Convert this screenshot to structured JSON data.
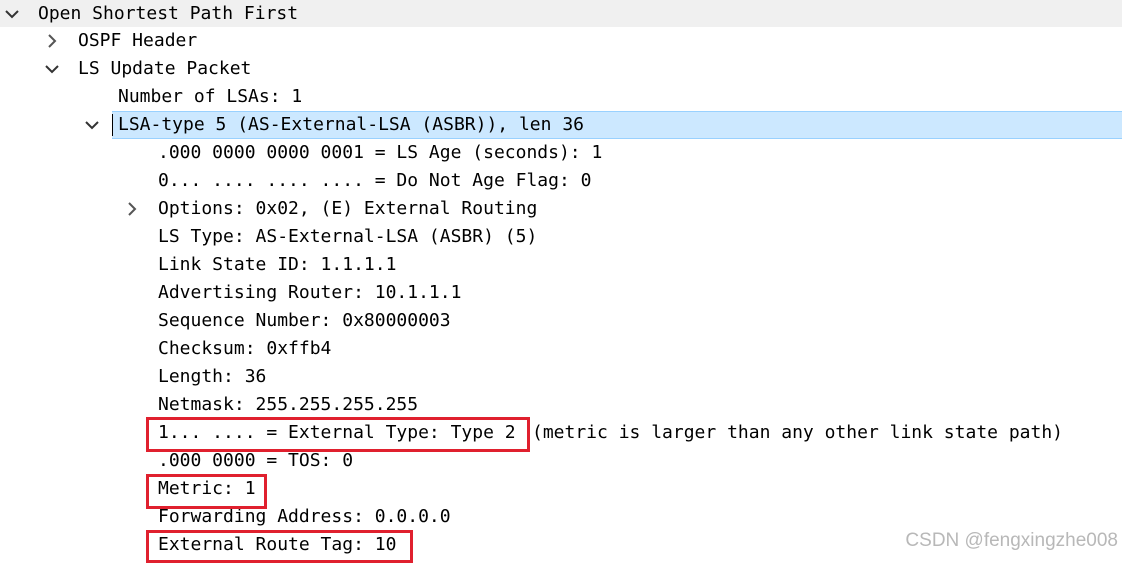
{
  "tree": {
    "root": {
      "label": "Open Shortest Path First",
      "expanded": true,
      "icon": "chevron-down-icon"
    },
    "ospf_header": {
      "label": "OSPF Header",
      "expanded": false,
      "icon": "chevron-right-icon"
    },
    "ls_update_packet": {
      "label": "LS Update Packet",
      "expanded": true,
      "icon": "chevron-down-icon"
    },
    "num_lsas": "Number of LSAs: 1",
    "lsa": {
      "label": "LSA-type 5 (AS-External-LSA (ASBR)), len 36",
      "expanded": true,
      "selected": true,
      "icon": "chevron-down-icon",
      "fields": {
        "ls_age": ".000 0000 0000 0001 = LS Age (seconds): 1",
        "do_not_age": "0... .... .... .... = Do Not Age Flag: 0",
        "options": "Options: 0x02, (E) External Routing",
        "ls_type": "LS Type: AS-External-LSA (ASBR) (5)",
        "link_state_id": "Link State ID: 1.1.1.1",
        "advertising_router": "Advertising Router: 10.1.1.1",
        "sequence_number": "Sequence Number: 0x80000003",
        "checksum": "Checksum: 0xffb4",
        "length": "Length: 36",
        "netmask": "Netmask: 255.255.255.255",
        "external_type": "1... .... = External Type: Type 2",
        "external_type_note": "(metric is larger than any other link state path)",
        "tos": ".000 0000 = TOS: 0",
        "metric": "Metric: 1",
        "forwarding_address": "Forwarding Address: 0.0.0.0",
        "external_route_tag": "External Route Tag: 10"
      }
    }
  },
  "colors": {
    "selection": "#cce8ff",
    "selection_border": "#99d1ff",
    "highlight_box": "#e0202e",
    "top_row": "#f0f0f0",
    "watermark": "#b8b8b8"
  },
  "watermark": "CSDN @fengxingzhe008"
}
